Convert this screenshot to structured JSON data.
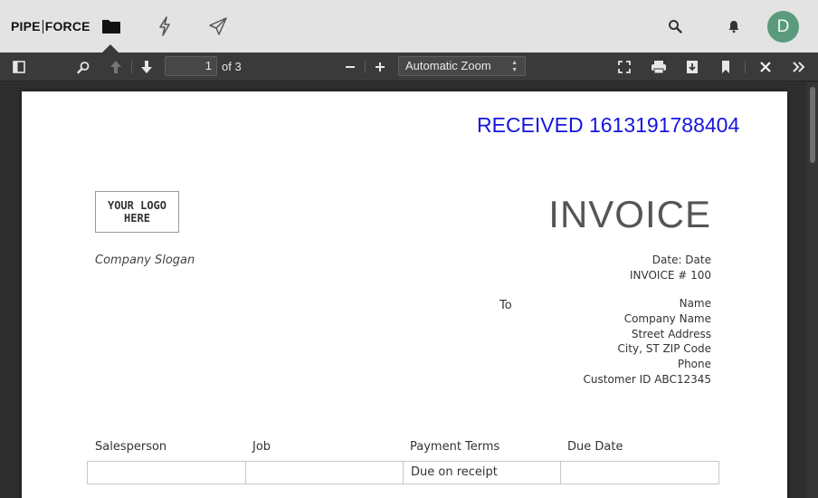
{
  "app": {
    "brand_left": "PIPE",
    "brand_right": "FORCE",
    "avatar_initial": "D",
    "avatar_color": "#5c9a7e"
  },
  "nav": {
    "icons": [
      "folder-icon",
      "lightning-icon",
      "send-icon"
    ],
    "right_icons": [
      "search-icon",
      "bell-icon"
    ]
  },
  "pdf_toolbar": {
    "current_page": "1",
    "page_count_label": "of 3",
    "zoom": "Automatic Zoom"
  },
  "document": {
    "stamp": "RECEIVED 1613191788404",
    "stamp_color": "#1515dd",
    "logo_placeholder_line1": "YOUR LOGO",
    "logo_placeholder_line2": "HERE",
    "slogan": "Company Slogan",
    "title": "INVOICE",
    "date_line": "Date: Date",
    "invoice_number": "INVOICE # 100",
    "to_label": "To",
    "recipient": {
      "name": "Name",
      "company": "Company Name",
      "street": "Street Address",
      "city": "City, ST ZIP Code",
      "phone": "Phone",
      "customer_id": "Customer ID ABC12345"
    },
    "table": {
      "headers": [
        "Salesperson",
        "Job",
        "Payment Terms",
        "Due Date"
      ],
      "rows": [
        [
          "",
          "",
          "Due on receipt",
          ""
        ]
      ]
    }
  }
}
